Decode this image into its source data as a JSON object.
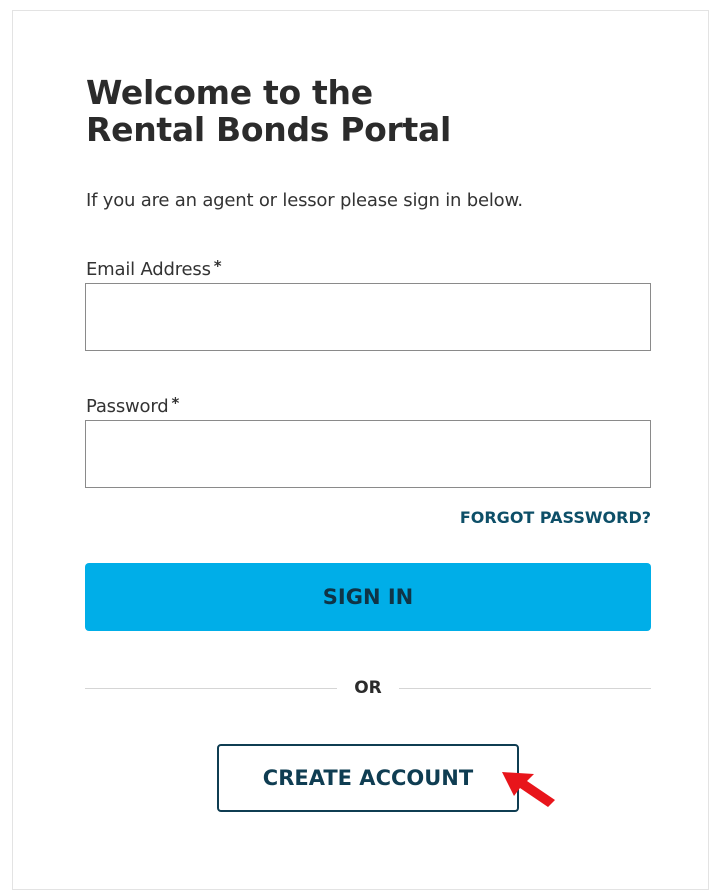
{
  "header": {
    "title_line1": "Welcome to the",
    "title_line2": "Rental Bonds Portal"
  },
  "intro_text": "If you are an agent or lessor please sign in below.",
  "form": {
    "email": {
      "label": "Email Address",
      "required_marker": "*",
      "value": ""
    },
    "password": {
      "label": "Password",
      "required_marker": "*",
      "value": ""
    },
    "forgot_password_label": "FORGOT PASSWORD?",
    "sign_in_label": "SIGN IN"
  },
  "divider_text": "OR",
  "create_account_label": "CREATE ACCOUNT",
  "annotation": {
    "icon": "red-arrow-pointer",
    "color": "#e8151b"
  },
  "colors": {
    "primary_button": "#00aee8",
    "link": "#0d4f68",
    "outline_button": "#0f3d52"
  }
}
